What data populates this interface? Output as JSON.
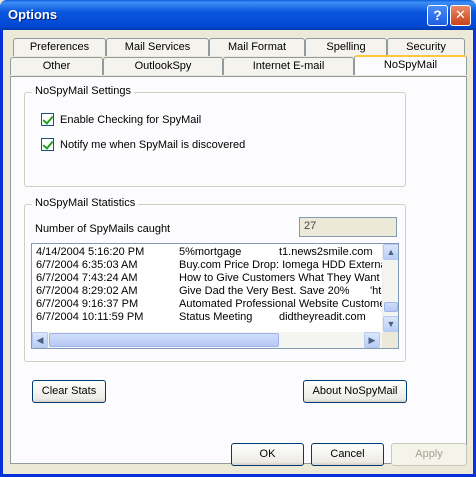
{
  "window": {
    "title": "Options",
    "help_glyph": "?",
    "close_glyph": "✕"
  },
  "tabs_row1": [
    "Preferences",
    "Mail Services",
    "Mail Format",
    "Spelling",
    "Security"
  ],
  "tabs_row2": [
    "Other",
    "OutlookSpy",
    "Internet E-mail",
    "NoSpyMail"
  ],
  "active_tab": "NoSpyMail",
  "settings": {
    "group_title": "NoSpyMail Settings",
    "enable_label": "Enable Checking for SpyMail",
    "notify_label": "Notify me when SpyMail is discovered",
    "enable_checked": true,
    "notify_checked": true
  },
  "stats": {
    "group_title": "NoSpyMail Statistics",
    "count_label": "Number of SpyMails caught",
    "count_value": "27",
    "rows": [
      {
        "date": "4/14/2004 5:16:20 PM",
        "subject": "5%mortgage",
        "extra": "t1.news2smile.com"
      },
      {
        "date": "6/7/2004 6:35:03 AM",
        "subject": "Buy.com Price Drop: Iomega HDD External",
        "extra": ""
      },
      {
        "date": "6/7/2004 7:43:24 AM",
        "subject": "How to Give Customers What They Want",
        "extra": ""
      },
      {
        "date": "6/7/2004 8:29:02 AM",
        "subject": "Give Dad the Very Best. Save 20%",
        "extra": "'ht"
      },
      {
        "date": "6/7/2004 9:16:37 PM",
        "subject": "Automated Professional Website Customer",
        "extra": ""
      },
      {
        "date": "6/7/2004 10:11:59 PM",
        "subject": "Status Meeting",
        "extra": "didtheyreadit.com"
      }
    ]
  },
  "buttons": {
    "clear_stats": "Clear Stats",
    "about": "About NoSpyMail",
    "ok": "OK",
    "cancel": "Cancel",
    "apply": "Apply"
  }
}
